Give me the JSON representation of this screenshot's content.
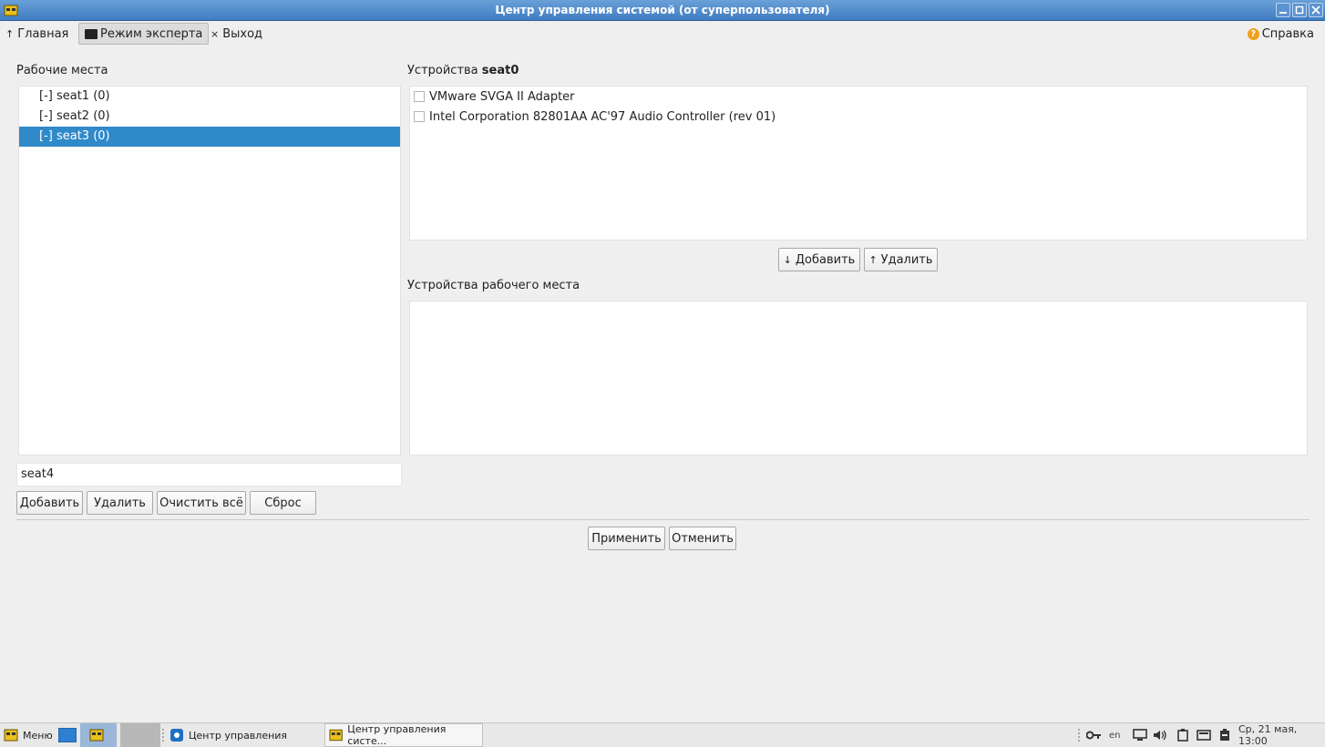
{
  "window": {
    "title": "Центр управления системой (от суперпользователя)"
  },
  "toolbar": {
    "home": "Главная",
    "expert_mode": "Режим эксперта",
    "exit": "Выход",
    "help": "Справка"
  },
  "seats": {
    "heading": "Рабочие места",
    "items": [
      "[-] seat1 (0)",
      "[-] seat2 (0)",
      "[-] seat3 (0)"
    ],
    "selected_index": 2,
    "input_value": "seat4",
    "buttons": {
      "add": "Добавить",
      "remove": "Удалить",
      "clear_all": "Очистить всё",
      "reset": "Сброс"
    }
  },
  "devices": {
    "heading_prefix": "Устройства",
    "heading_seat": "seat0",
    "items": [
      "VMware SVGA II Adapter",
      "Intel Corporation 82801AA AC'97 Audio Controller (rev 01)"
    ],
    "add_button": "Добавить",
    "remove_button": "Удалить"
  },
  "seat_devices": {
    "heading": "Устройства рабочего места"
  },
  "dialog": {
    "apply": "Применить",
    "cancel": "Отменить"
  },
  "taskbar": {
    "menu": "Меню",
    "task1": "Центр управления",
    "task2": "Центр управления систе...",
    "lang": "en",
    "clock": "Ср, 21 мая, 13:00"
  },
  "colors": {
    "titlebar": "#4a88cc",
    "selection": "#3089c9",
    "help_icon": "#f0a020"
  }
}
